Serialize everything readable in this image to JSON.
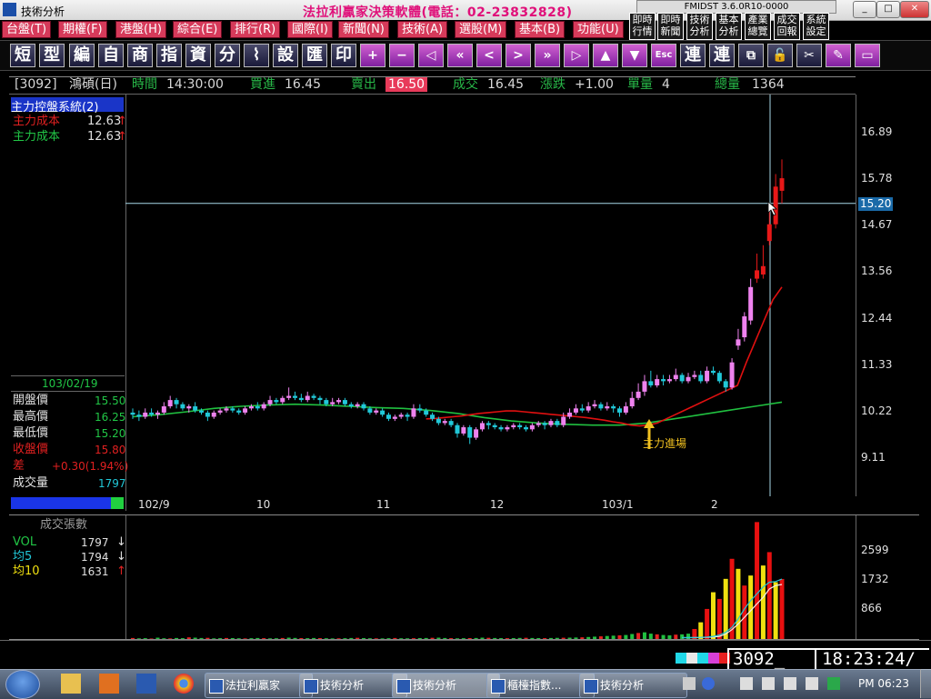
{
  "window": {
    "title": "技術分析",
    "brand": "法拉利贏家決策軟體(電話：02-23832828)",
    "version": "FMIDST 3.6.0R10-0000",
    "buttons": {
      "minimize": "_",
      "maximize": "□",
      "close": "✕"
    }
  },
  "menu": [
    "台盤(T)",
    "期權(F)",
    "港盤(H)",
    "綜合(E)",
    "排行(R)",
    "國際(I)",
    "新聞(N)",
    "技術(A)",
    "選股(M)",
    "基本(B)",
    "功能(U)"
  ],
  "quick_buttons": [
    {
      "l1": "即時",
      "l2": "行情"
    },
    {
      "l1": "即時",
      "l2": "新聞"
    },
    {
      "l1": "技術",
      "l2": "分析"
    },
    {
      "l1": "基本",
      "l2": "分析"
    },
    {
      "l1": "產業",
      "l2": "總覽"
    },
    {
      "l1": "成交",
      "l2": "回報"
    },
    {
      "l1": "系統",
      "l2": "設定"
    }
  ],
  "toolbar": [
    "短",
    "型",
    "編",
    "自",
    "商",
    "指",
    "資",
    "分",
    "⌇",
    "設",
    "匯",
    "印",
    "+",
    "−",
    "◁",
    "«",
    "<",
    ">",
    "»",
    "▷",
    "▲",
    "▼",
    "Esc",
    "連",
    "連",
    "⧉",
    "🔓",
    "✂",
    "✎",
    "▭"
  ],
  "quote": {
    "code": "[3092]",
    "name": "鴻碩(日)",
    "time_label": "時間",
    "time": "14:30:00",
    "bid_label": "買進",
    "bid": "16.45",
    "ask_label": "賣出",
    "ask": "16.50",
    "deal_label": "成交",
    "deal": "16.45",
    "change_label": "漲跌",
    "change": "+1.00",
    "unit_label": "單量",
    "unit": "4",
    "total_label": "總量",
    "total": "1364"
  },
  "left_panel": {
    "system": "主力控盤系統(2)",
    "cost1_label": "主力成本",
    "cost1": "12.63",
    "cost2_label": "主力成本",
    "cost2": "12.63",
    "arrow_up": "↑",
    "arrow_down": "↓",
    "date": "103/02/19",
    "open_label": "開盤價",
    "open": "15.50",
    "high_label": "最高價",
    "high": "16.25",
    "low_label": "最低價",
    "low": "15.20",
    "close_label": "收盤價",
    "close": "15.80",
    "diff_label": "差",
    "diff": "+0.30(1.94%)",
    "vol_label": "成交量",
    "vol": "1797"
  },
  "volume_panel": {
    "title": "成交張數",
    "vol_label": "VOL",
    "vol": "1797",
    "ma5_label": "均5",
    "ma5": "1794",
    "ma10_label": "均10",
    "ma10": "1631"
  },
  "annotation": "主力進場",
  "colors": {
    "up": "#ee82ee",
    "down": "#21c8d8",
    "ma_red": "#e01010",
    "ma_green": "#20c040",
    "vol_red": "#e81010",
    "vol_yellow": "#f0e010"
  },
  "chart_data": {
    "type": "candlestick",
    "price_axis": {
      "ticks": [
        16.89,
        15.78,
        14.67,
        13.56,
        12.44,
        11.33,
        10.22,
        9.11
      ],
      "ylim": [
        8.2,
        17.8
      ],
      "crosshair_price": "15.20"
    },
    "x_axis": {
      "labels": [
        "102/9",
        "10",
        "11",
        "12",
        "103/1",
        "2"
      ]
    },
    "candles": [
      [
        10.2,
        10.15,
        10.3,
        10.05
      ],
      [
        10.15,
        10.1,
        10.25,
        10.0
      ],
      [
        10.1,
        10.2,
        10.3,
        10.05
      ],
      [
        10.2,
        10.15,
        10.3,
        10.1
      ],
      [
        10.15,
        10.2,
        10.25,
        10.05
      ],
      [
        10.2,
        10.35,
        10.45,
        10.15
      ],
      [
        10.35,
        10.5,
        10.6,
        10.3
      ],
      [
        10.5,
        10.4,
        10.55,
        10.3
      ],
      [
        10.4,
        10.3,
        10.45,
        10.25
      ],
      [
        10.3,
        10.35,
        10.4,
        10.2
      ],
      [
        10.35,
        10.25,
        10.45,
        10.2
      ],
      [
        10.25,
        10.2,
        10.3,
        10.15
      ],
      [
        10.2,
        10.1,
        10.25,
        10.0
      ],
      [
        10.1,
        10.2,
        10.25,
        10.05
      ],
      [
        10.2,
        10.25,
        10.3,
        10.15
      ],
      [
        10.25,
        10.3,
        10.35,
        10.2
      ],
      [
        10.3,
        10.25,
        10.35,
        10.2
      ],
      [
        10.25,
        10.2,
        10.3,
        10.15
      ],
      [
        10.2,
        10.3,
        10.35,
        10.15
      ],
      [
        10.3,
        10.35,
        10.4,
        10.25
      ],
      [
        10.35,
        10.3,
        10.45,
        10.25
      ],
      [
        10.3,
        10.4,
        10.45,
        10.25
      ],
      [
        10.4,
        10.5,
        10.6,
        10.35
      ],
      [
        10.5,
        10.45,
        10.55,
        10.4
      ],
      [
        10.45,
        10.55,
        10.6,
        10.4
      ],
      [
        10.55,
        10.6,
        10.8,
        10.5
      ],
      [
        10.6,
        10.55,
        10.7,
        10.5
      ],
      [
        10.55,
        10.5,
        10.65,
        10.45
      ],
      [
        10.5,
        10.6,
        10.7,
        10.45
      ],
      [
        10.6,
        10.55,
        10.65,
        10.5
      ],
      [
        10.55,
        10.5,
        10.6,
        10.4
      ],
      [
        10.5,
        10.4,
        10.55,
        10.35
      ],
      [
        10.4,
        10.45,
        10.55,
        10.35
      ],
      [
        10.45,
        10.5,
        10.55,
        10.4
      ],
      [
        10.5,
        10.4,
        10.55,
        10.35
      ],
      [
        10.4,
        10.35,
        10.45,
        10.3
      ],
      [
        10.35,
        10.4,
        10.45,
        10.3
      ],
      [
        10.4,
        10.3,
        10.45,
        10.25
      ],
      [
        10.3,
        10.2,
        10.35,
        10.15
      ],
      [
        10.2,
        10.25,
        10.3,
        10.15
      ],
      [
        10.25,
        10.15,
        10.3,
        10.1
      ],
      [
        10.15,
        10.05,
        10.2,
        10.0
      ],
      [
        10.05,
        10.1,
        10.15,
        10.0
      ],
      [
        10.1,
        10.15,
        10.2,
        10.05
      ],
      [
        10.15,
        10.1,
        10.2,
        10.0
      ],
      [
        10.1,
        10.3,
        10.4,
        10.05
      ],
      [
        10.3,
        10.25,
        10.4,
        10.2
      ],
      [
        10.25,
        10.15,
        10.3,
        10.1
      ],
      [
        10.15,
        10.05,
        10.2,
        10.0
      ],
      [
        10.05,
        9.95,
        10.1,
        9.9
      ],
      [
        9.95,
        10.0,
        10.05,
        9.9
      ],
      [
        10.0,
        9.9,
        10.05,
        9.85
      ],
      [
        9.9,
        9.7,
        9.95,
        9.6
      ],
      [
        9.7,
        9.85,
        9.9,
        9.65
      ],
      [
        9.85,
        9.6,
        9.9,
        9.45
      ],
      [
        9.6,
        9.8,
        9.85,
        9.55
      ],
      [
        9.8,
        9.95,
        10.0,
        9.75
      ],
      [
        9.95,
        9.9,
        10.0,
        9.8
      ],
      [
        9.9,
        9.85,
        9.95,
        9.8
      ],
      [
        9.85,
        9.8,
        9.9,
        9.75
      ],
      [
        9.8,
        9.85,
        9.9,
        9.75
      ],
      [
        9.85,
        9.9,
        9.95,
        9.8
      ],
      [
        9.9,
        9.85,
        9.95,
        9.8
      ],
      [
        9.85,
        9.8,
        9.9,
        9.75
      ],
      [
        9.8,
        9.9,
        9.95,
        9.75
      ],
      [
        9.9,
        9.95,
        10.0,
        9.85
      ],
      [
        9.95,
        9.9,
        10.0,
        9.8
      ],
      [
        9.9,
        10.0,
        10.05,
        9.85
      ],
      [
        10.0,
        9.9,
        10.05,
        9.85
      ],
      [
        9.9,
        10.1,
        10.2,
        9.85
      ],
      [
        10.1,
        10.2,
        10.3,
        10.05
      ],
      [
        10.2,
        10.3,
        10.4,
        10.15
      ],
      [
        10.3,
        10.25,
        10.4,
        10.2
      ],
      [
        10.25,
        10.35,
        10.45,
        10.2
      ],
      [
        10.35,
        10.4,
        10.5,
        10.3
      ],
      [
        10.4,
        10.3,
        10.45,
        10.25
      ],
      [
        10.3,
        10.35,
        10.45,
        10.25
      ],
      [
        10.35,
        10.3,
        10.4,
        10.2
      ],
      [
        10.3,
        10.2,
        10.35,
        10.1
      ],
      [
        10.2,
        10.35,
        10.45,
        10.15
      ],
      [
        10.35,
        10.55,
        10.7,
        10.3
      ],
      [
        10.55,
        10.7,
        10.9,
        10.5
      ],
      [
        10.7,
        10.95,
        11.1,
        10.6
      ],
      [
        10.95,
        10.85,
        11.2,
        10.8
      ],
      [
        10.85,
        11.0,
        11.1,
        10.8
      ],
      [
        11.0,
        10.95,
        11.1,
        10.85
      ],
      [
        10.95,
        11.0,
        11.1,
        10.9
      ],
      [
        11.0,
        11.1,
        11.25,
        10.95
      ],
      [
        11.1,
        10.95,
        11.15,
        10.9
      ],
      [
        10.95,
        11.05,
        11.15,
        10.9
      ],
      [
        11.05,
        11.1,
        11.2,
        11.0
      ],
      [
        11.1,
        10.95,
        11.2,
        10.9
      ],
      [
        10.95,
        11.2,
        11.3,
        10.9
      ],
      [
        11.2,
        11.15,
        11.3,
        11.1
      ],
      [
        11.15,
        10.95,
        11.2,
        10.9
      ],
      [
        10.95,
        10.8,
        11.0,
        10.7
      ],
      [
        10.8,
        11.4,
        11.5,
        10.75
      ],
      [
        11.8,
        11.95,
        12.2,
        11.7
      ],
      [
        12.0,
        12.5,
        12.6,
        11.9
      ],
      [
        12.4,
        13.2,
        13.4,
        12.3
      ],
      [
        13.4,
        13.6,
        14.0,
        13.3
      ],
      [
        13.5,
        13.7,
        14.2,
        13.4
      ],
      [
        14.3,
        14.7,
        15.0,
        14.2
      ],
      [
        14.7,
        15.6,
        15.9,
        14.6
      ],
      [
        15.5,
        15.8,
        16.25,
        15.2
      ]
    ],
    "ma_red": [
      10.05,
      10.06,
      10.08,
      10.1,
      10.12,
      10.15,
      10.18,
      10.2,
      10.22,
      10.24,
      10.24,
      10.22,
      10.2,
      10.18,
      10.16,
      10.14,
      10.12,
      10.1,
      10.08,
      10.05,
      10.02,
      9.98,
      9.95,
      9.9,
      9.88,
      9.9,
      9.95,
      10.05,
      10.15,
      10.25,
      10.35,
      10.45,
      10.55,
      10.65,
      10.75,
      10.85,
      11.4,
      11.9,
      12.4,
      12.9,
      13.2
    ],
    "ma_green": [
      10.1,
      10.15,
      10.22,
      10.3,
      10.35,
      10.38,
      10.4,
      10.38,
      10.35,
      10.32,
      10.3,
      10.25,
      10.18,
      10.08,
      10.0,
      9.95,
      9.92,
      9.9,
      9.9,
      9.95,
      10.05,
      10.15,
      10.25,
      10.35,
      10.45
    ],
    "volume": {
      "ticks": [
        2599,
        1732,
        866
      ],
      "ylim": [
        0,
        3700
      ],
      "bars": [
        30,
        20,
        25,
        15,
        40,
        22,
        18,
        30,
        25,
        50,
        40,
        30,
        35,
        20,
        25,
        30,
        28,
        22,
        18,
        24,
        30,
        26,
        20,
        22,
        30,
        40,
        32,
        28,
        24,
        30,
        26,
        22,
        18,
        20,
        24,
        30,
        36,
        28,
        22,
        20,
        18,
        24,
        30,
        22,
        20,
        24,
        28,
        30,
        36,
        40,
        30,
        26,
        20,
        24,
        28,
        30,
        40,
        36,
        30,
        26,
        24,
        28,
        32,
        36,
        30,
        28,
        26,
        30,
        34,
        38,
        40,
        44,
        50,
        60,
        70,
        80,
        90,
        100,
        110,
        120,
        150,
        180,
        200,
        160,
        140,
        120,
        110,
        130,
        140,
        160,
        300,
        500,
        900,
        1400,
        1200,
        1800,
        2400,
        2100,
        1600,
        1900,
        3500,
        2200,
        2600,
        1700,
        1797
      ],
      "ma5": [
        40,
        40,
        45,
        50,
        60,
        80,
        120,
        200,
        350,
        600,
        900,
        1150,
        1350,
        1560,
        1700,
        1720,
        1794
      ],
      "ma10": [
        40,
        40,
        42,
        45,
        50,
        60,
        80,
        150,
        280,
        450,
        650,
        850,
        1050,
        1250,
        1500,
        1600,
        1631
      ]
    }
  },
  "status": {
    "stock_no": "3092_",
    "clock": "18:23:24/"
  },
  "taskbar": {
    "tasks": [
      "法拉利贏家",
      "技術分析",
      "技術分析",
      "櫃檯指數...",
      "技術分析"
    ],
    "time": "PM 06:23"
  }
}
